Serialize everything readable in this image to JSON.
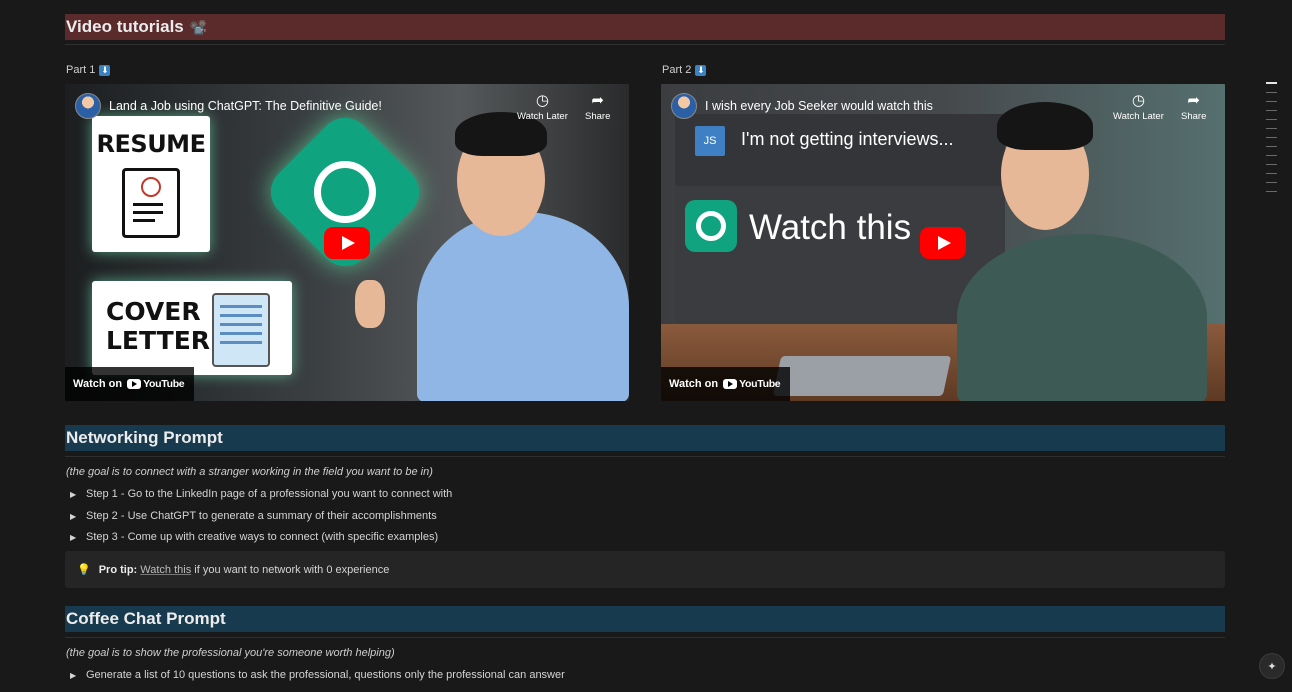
{
  "sections": {
    "video_tutorials": {
      "title": "Video tutorials",
      "emoji": "📽️"
    },
    "networking": {
      "title": "Networking Prompt",
      "subtitle": "(the goal is to connect with a stranger working in the field you want to be in)",
      "steps": [
        "Step 1 - Go to the LinkedIn page of a professional you want to connect with",
        "Step 2 - Use ChatGPT to generate a summary of their accomplishments",
        "Step 3 - Come up with creative ways to connect (with specific examples)"
      ],
      "tip": {
        "icon": "💡",
        "label": "Pro tip:",
        "link": "Watch this",
        "rest": " if you want to network with 0 experience"
      }
    },
    "coffee": {
      "title": "Coffee Chat Prompt",
      "subtitle": "(the goal is to show the professional you're someone worth helping)",
      "steps": [
        "Generate a list of 10 questions to ask the professional, questions only the professional can answer"
      ]
    }
  },
  "videos": [
    {
      "part_label": "Part 1",
      "title": "Land a Job using ChatGPT: The Definitive Guide!",
      "watch_later": "Watch Later",
      "share": "Share",
      "watch_on": "Watch on",
      "youtube": "YouTube",
      "thumb_text": {
        "resume": "RESUME",
        "cover": "COVER",
        "letter": "LETTER"
      }
    },
    {
      "part_label": "Part 2",
      "title": "I wish every Job Seeker would watch this",
      "watch_later": "Watch Later",
      "share": "Share",
      "watch_on": "Watch on",
      "youtube": "YouTube",
      "thumb_text": {
        "avatar": "JS",
        "message": "I'm not getting interviews...",
        "watch": "Watch this"
      }
    }
  ],
  "colors": {
    "heading_red": "#5b2b2b",
    "heading_blue": "#183a4e",
    "bg": "#191919",
    "callout_bg": "#252525"
  },
  "fab_icon": "✦"
}
